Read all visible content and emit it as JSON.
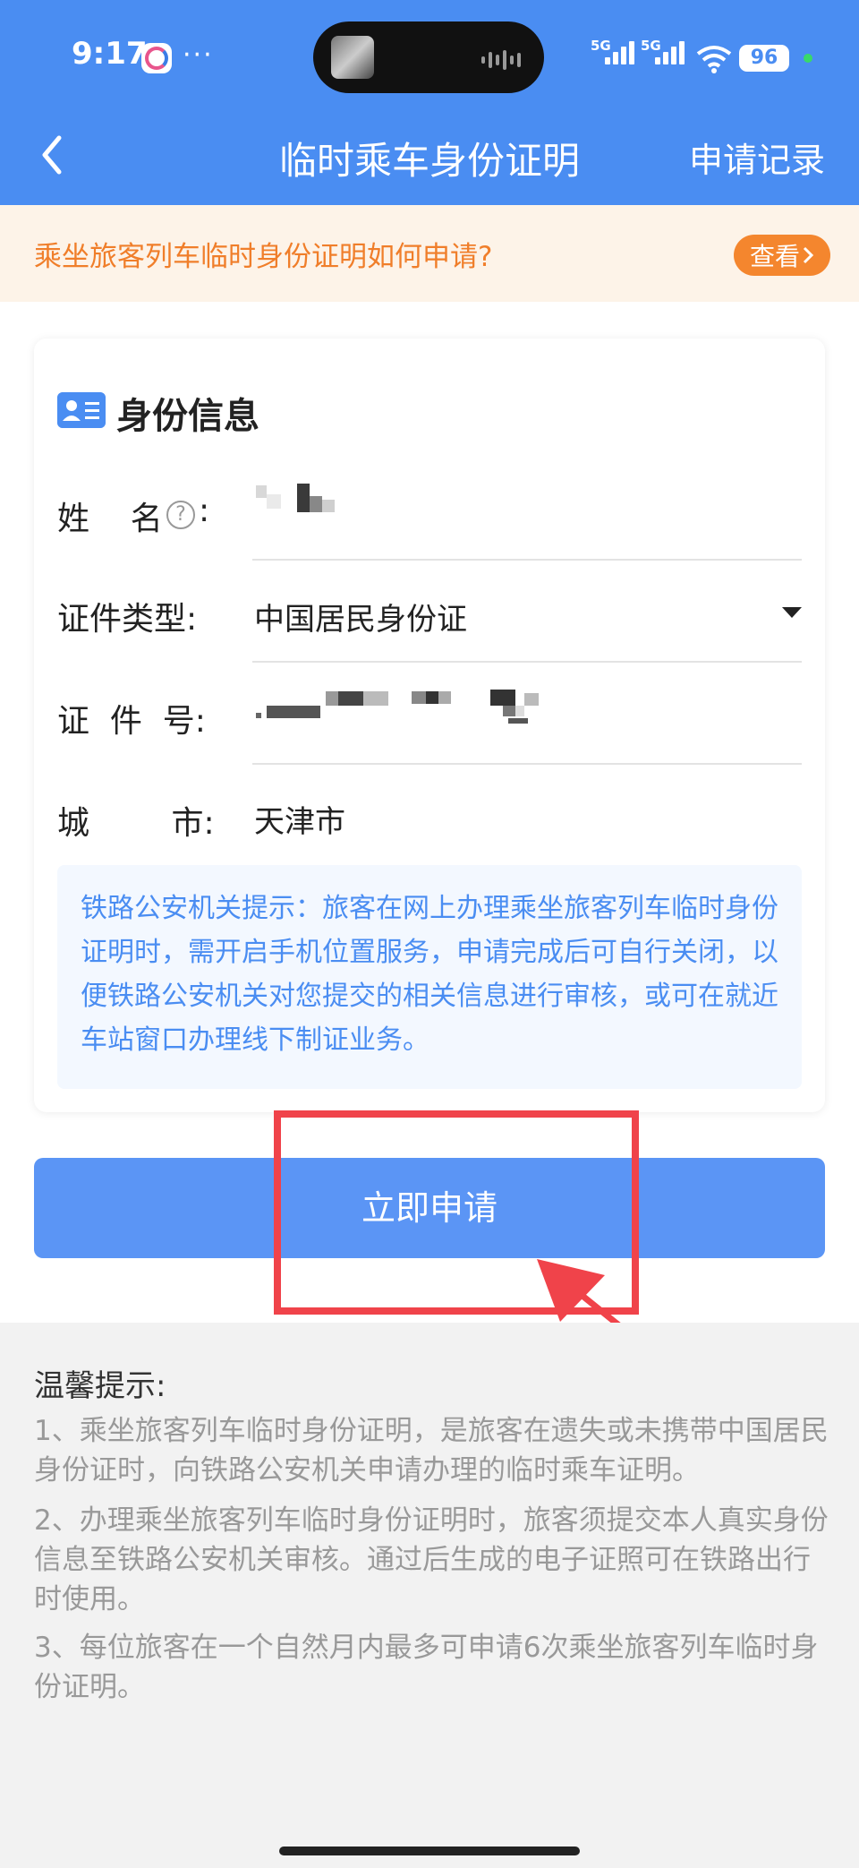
{
  "status_bar": {
    "time": "9:17",
    "more": "···",
    "signal_1": "5G",
    "signal_2": "5G",
    "battery": "96"
  },
  "nav": {
    "title": "临时乘车身份证明",
    "right_link": "申请记录"
  },
  "notice": {
    "text": "乘坐旅客列车临时身份证明如何申请?",
    "button": "查看"
  },
  "card": {
    "title": "身份信息",
    "fields": {
      "name": {
        "label": "姓    名",
        "colon": ":"
      },
      "id_type": {
        "label": "证件类型:",
        "value": "中国居民身份证"
      },
      "id_number": {
        "label": "证  件  号:"
      },
      "city": {
        "label": "城        市:",
        "value": "天津市"
      }
    },
    "tip": "铁路公安机关提示：旅客在网上办理乘坐旅客列车临时身份证明时，需开启手机位置服务，申请完成后可自行关闭，以便铁路公安机关对您提交的相关信息进行审核，或可在就近车站窗口办理线下制证业务。"
  },
  "apply_button": "立即申请",
  "warm_tips": {
    "title": "温馨提示:",
    "items": [
      "1、乘坐旅客列车临时身份证明，是旅客在遗失或未携带中国居民身份证时，向铁路公安机关申请办理的临时乘车证明。",
      "2、办理乘坐旅客列车临时身份证明时，旅客须提交本人真实身份信息至铁路公安机关审核。通过后生成的电子证照可在铁路出行时使用。",
      "3、每位旅客在一个自然月内最多可申请6次乘坐旅客列车临时身份证明。"
    ]
  },
  "colors": {
    "primary": "#4a8df2",
    "button": "#5b95f5",
    "notice_text": "#f07e2a",
    "highlight": "#f0434a"
  }
}
